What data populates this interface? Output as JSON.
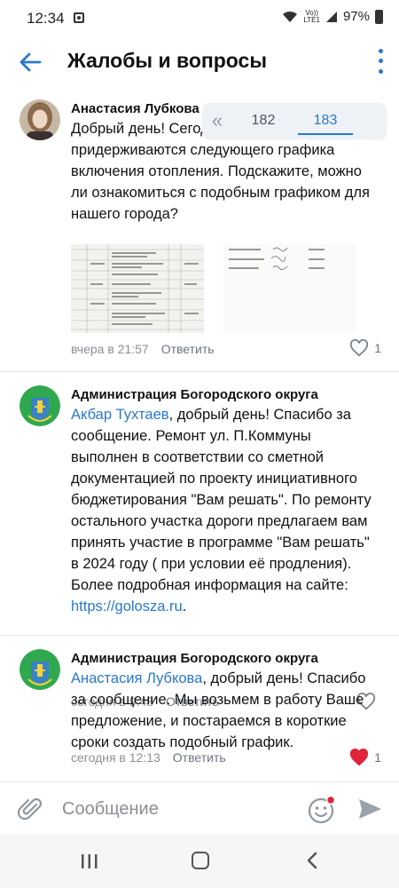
{
  "status_bar": {
    "time": "12:34",
    "lte_label": "Vo))\nLTE1",
    "battery": "97%"
  },
  "header": {
    "title": "Жалобы и вопросы"
  },
  "pager": {
    "pages": [
      "182",
      "183"
    ],
    "active": "183"
  },
  "comments": [
    {
      "author": "Анастасия Лубкова",
      "text": "Добрый день! Сегодня в г.Е опубликовали и придерживаются следующего графика включения отопления. Подскажите,  можно ли ознакомиться с подобным графиком для нашего города?",
      "time": "вчера в 21:57",
      "reply_label": "Ответить",
      "likes": "1",
      "liked": false
    },
    {
      "author": "Администрация Богородского округа",
      "mention": "Акбар Тухтаев",
      "text": ", добрый день! Спасибо за сообщение. Ремонт ул. П.Коммуны выполнен в соответствии со сметной документацией по проекту инициативного бюджетирования \"Вам решать\". По ремонту остального участка дороги предлагаем вам принять участие в программе \"Вам решать\" в 2024 году ( при условии её продления). Более подробная информация на сайте: ",
      "link": "https://golosza.ru",
      "text_end": ".",
      "time": "сегодня в 9:48",
      "reply_label": "Ответить",
      "likes": "",
      "liked": false
    },
    {
      "author": "Администрация Богородского округа",
      "mention": "Анастасия Лубкова",
      "text": ", добрый день! Спасибо за сообщение. Мы возьмем в работу Ваше предложение, и постараемся в короткие сроки создать подобный график.",
      "time": "сегодня в 12:13",
      "reply_label": "Ответить",
      "likes": "1",
      "liked": true
    }
  ],
  "composer": {
    "placeholder": "Сообщение"
  },
  "colors": {
    "accent": "#2a78c9",
    "liked": "#e0253a",
    "muted": "#8a8f96"
  },
  "icons": [
    "back-arrow-icon",
    "more-vertical-icon",
    "heart-icon",
    "paperclip-icon",
    "emoji-icon",
    "send-icon",
    "recent-apps-icon",
    "home-icon",
    "nav-back-icon",
    "wifi-icon",
    "signal-icon",
    "battery-icon"
  ]
}
